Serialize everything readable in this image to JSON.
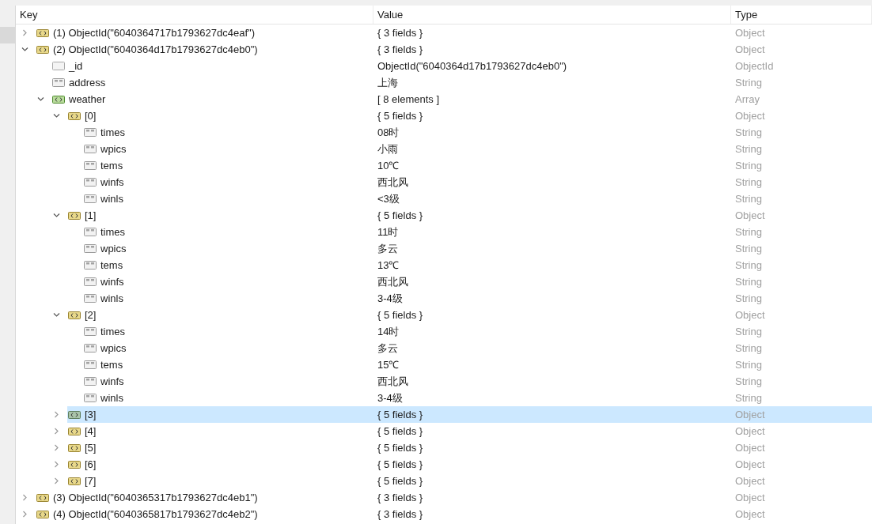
{
  "columns": [
    "Key",
    "Value",
    "Type"
  ],
  "rows": [
    {
      "kind": "object",
      "key": "(1) ObjectId(\"6040364717b1793627dc4eaf\")",
      "value": "{ 3 fields }",
      "type": "Object",
      "expanded": false,
      "selected": false
    },
    {
      "kind": "object",
      "key": "(2) ObjectId(\"6040364d17b1793627dc4eb0\")",
      "value": "{ 3 fields }",
      "type": "Object",
      "expanded": true,
      "selected": false,
      "children": [
        {
          "kind": "id",
          "key": "_id",
          "value": "ObjectId(\"6040364d17b1793627dc4eb0\")",
          "type": "ObjectId",
          "selected": false
        },
        {
          "kind": "string",
          "key": "address",
          "value": "上海",
          "type": "String",
          "selected": false
        },
        {
          "kind": "array",
          "key": "weather",
          "value": "[ 8 elements ]",
          "type": "Array",
          "expanded": true,
          "selected": false,
          "children": [
            {
              "kind": "object",
              "key": "[0]",
              "value": "{ 5 fields }",
              "type": "Object",
              "expanded": true,
              "selected": false,
              "children": [
                {
                  "kind": "string",
                  "key": "times",
                  "value": "08时",
                  "type": "String",
                  "selected": false
                },
                {
                  "kind": "string",
                  "key": "wpics",
                  "value": "小雨",
                  "type": "String",
                  "selected": false
                },
                {
                  "kind": "string",
                  "key": "tems",
                  "value": "10℃",
                  "type": "String",
                  "selected": false
                },
                {
                  "kind": "string",
                  "key": "winfs",
                  "value": "西北风",
                  "type": "String",
                  "selected": false
                },
                {
                  "kind": "string",
                  "key": "winls",
                  "value": "<3级",
                  "type": "String",
                  "selected": false
                }
              ]
            },
            {
              "kind": "object",
              "key": "[1]",
              "value": "{ 5 fields }",
              "type": "Object",
              "expanded": true,
              "selected": false,
              "children": [
                {
                  "kind": "string",
                  "key": "times",
                  "value": "11时",
                  "type": "String",
                  "selected": false
                },
                {
                  "kind": "string",
                  "key": "wpics",
                  "value": "多云",
                  "type": "String",
                  "selected": false
                },
                {
                  "kind": "string",
                  "key": "tems",
                  "value": "13℃",
                  "type": "String",
                  "selected": false
                },
                {
                  "kind": "string",
                  "key": "winfs",
                  "value": "西北风",
                  "type": "String",
                  "selected": false
                },
                {
                  "kind": "string",
                  "key": "winls",
                  "value": "3-4级",
                  "type": "String",
                  "selected": false
                }
              ]
            },
            {
              "kind": "object",
              "key": "[2]",
              "value": "{ 5 fields }",
              "type": "Object",
              "expanded": true,
              "selected": false,
              "children": [
                {
                  "kind": "string",
                  "key": "times",
                  "value": "14时",
                  "type": "String",
                  "selected": false
                },
                {
                  "kind": "string",
                  "key": "wpics",
                  "value": "多云",
                  "type": "String",
                  "selected": false
                },
                {
                  "kind": "string",
                  "key": "tems",
                  "value": "15℃",
                  "type": "String",
                  "selected": false
                },
                {
                  "kind": "string",
                  "key": "winfs",
                  "value": "西北风",
                  "type": "String",
                  "selected": false
                },
                {
                  "kind": "string",
                  "key": "winls",
                  "value": "3-4级",
                  "type": "String",
                  "selected": false
                }
              ]
            },
            {
              "kind": "object",
              "key": "[3]",
              "value": "{ 5 fields }",
              "type": "Object",
              "expanded": false,
              "selected": true
            },
            {
              "kind": "object",
              "key": "[4]",
              "value": "{ 5 fields }",
              "type": "Object",
              "expanded": false,
              "selected": false
            },
            {
              "kind": "object",
              "key": "[5]",
              "value": "{ 5 fields }",
              "type": "Object",
              "expanded": false,
              "selected": false
            },
            {
              "kind": "object",
              "key": "[6]",
              "value": "{ 5 fields }",
              "type": "Object",
              "expanded": false,
              "selected": false
            },
            {
              "kind": "object",
              "key": "[7]",
              "value": "{ 5 fields }",
              "type": "Object",
              "expanded": false,
              "selected": false
            }
          ]
        }
      ]
    },
    {
      "kind": "object",
      "key": "(3) ObjectId(\"6040365317b1793627dc4eb1\")",
      "value": "{ 3 fields }",
      "type": "Object",
      "expanded": false,
      "selected": false
    },
    {
      "kind": "object",
      "key": "(4) ObjectId(\"6040365817b1793627dc4eb2\")",
      "value": "{ 3 fields }",
      "type": "Object",
      "expanded": false,
      "selected": false
    }
  ]
}
